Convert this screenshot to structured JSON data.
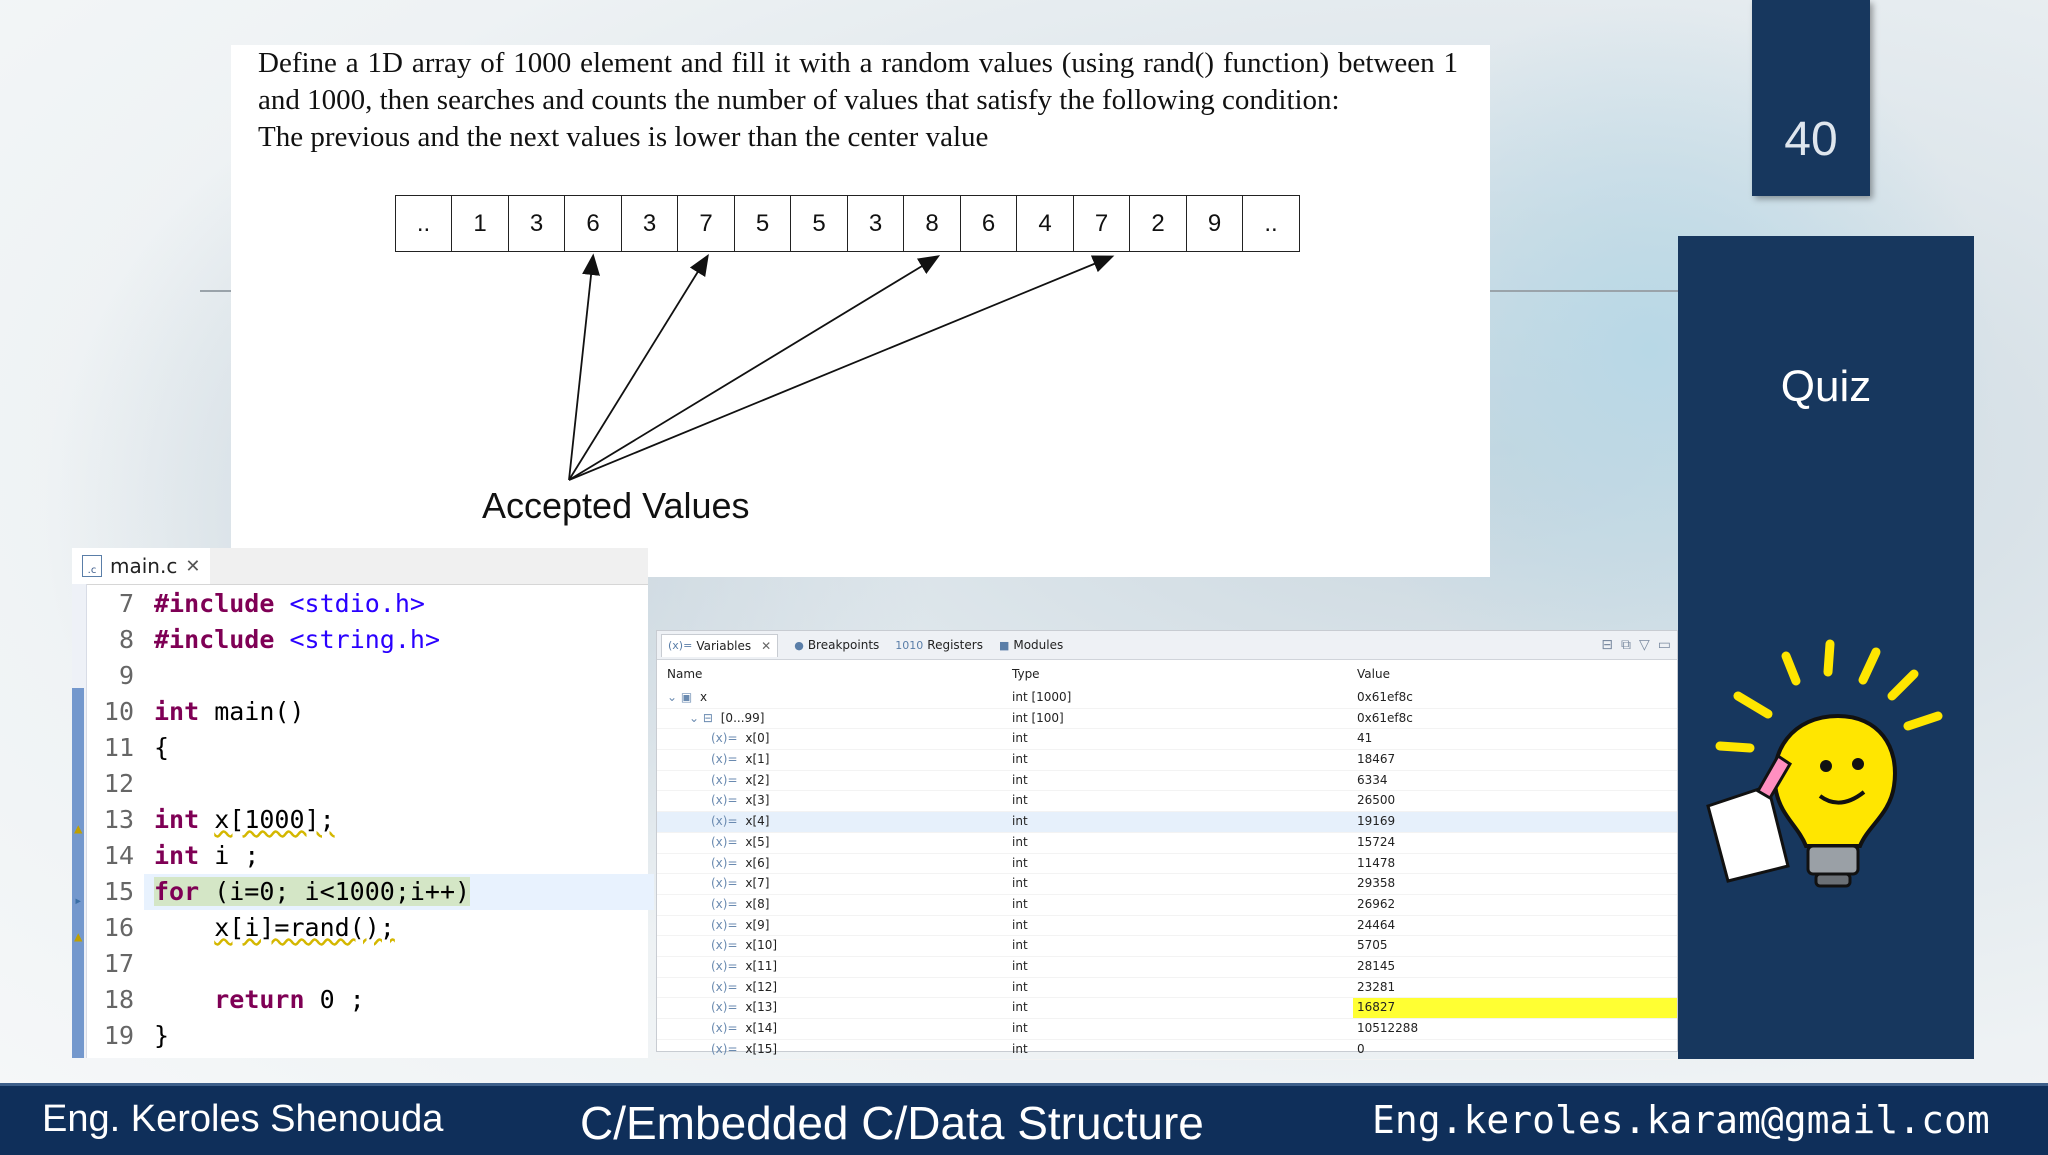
{
  "slide": {
    "number": "40",
    "quiz_title": "Quiz"
  },
  "problem": {
    "lines": [
      "Define a 1D array of 1000 element and fill it with a random values (using rand() function) between 1 and 1000, then searches and counts the number of values that satisfy the following condition:",
      "The previous and the next values is lower than the center value"
    ],
    "array_cells": [
      "..",
      "1",
      "3",
      "6",
      "3",
      "7",
      "5",
      "5",
      "3",
      "8",
      "6",
      "4",
      "7",
      "2",
      "9",
      ".."
    ],
    "accepted_label": "Accepted Values"
  },
  "editor": {
    "tab_label": "main.c",
    "code": [
      {
        "n": "7",
        "html": "<span class='kw'>#include</span> <span class='inc'>&lt;stdio.h&gt;</span>"
      },
      {
        "n": "8",
        "html": "<span class='kw'>#include</span> <span class='inc'>&lt;string.h&gt;</span>"
      },
      {
        "n": "9",
        "html": ""
      },
      {
        "n": "10",
        "html": "<span class='kw'>int</span> main()"
      },
      {
        "n": "11",
        "html": "{"
      },
      {
        "n": "12",
        "html": ""
      },
      {
        "n": "13",
        "html": "<span class='kw'>int</span> <span class='warn'>x[1000];</span>"
      },
      {
        "n": "14",
        "html": "<span class='kw'>int</span> i ;"
      },
      {
        "n": "15",
        "html": "<span class='hl-green'><span class='kw'>for</span> (i=0; i&lt;1000;i++)</span>"
      },
      {
        "n": "16",
        "html": "    <span class='warn'>x[i]=rand();</span>"
      },
      {
        "n": "17",
        "html": ""
      },
      {
        "n": "18",
        "html": "    <span class='kw'>return</span> 0 ;"
      },
      {
        "n": "19",
        "html": "}"
      }
    ]
  },
  "debugger": {
    "tabs": [
      {
        "icon": "(x)=",
        "label": "Variables"
      },
      {
        "icon": "●",
        "label": "Breakpoints"
      },
      {
        "icon": "1010",
        "label": "Registers"
      },
      {
        "icon": "■",
        "label": "Modules"
      }
    ],
    "headers": {
      "name": "Name",
      "type": "Type",
      "value": "Value"
    },
    "rows": [
      {
        "name": "x",
        "type": "int [1000]",
        "value": "0x61ef8c",
        "level": 0
      },
      {
        "name": "[0...99]",
        "type": "int [100]",
        "value": "0x61ef8c",
        "level": 1
      },
      {
        "name": "x[0]",
        "type": "int",
        "value": "41",
        "level": 2
      },
      {
        "name": "x[1]",
        "type": "int",
        "value": "18467",
        "level": 2
      },
      {
        "name": "x[2]",
        "type": "int",
        "value": "6334",
        "level": 2
      },
      {
        "name": "x[3]",
        "type": "int",
        "value": "26500",
        "level": 2
      },
      {
        "name": "x[4]",
        "type": "int",
        "value": "19169",
        "level": 2,
        "selected": true
      },
      {
        "name": "x[5]",
        "type": "int",
        "value": "15724",
        "level": 2
      },
      {
        "name": "x[6]",
        "type": "int",
        "value": "11478",
        "level": 2
      },
      {
        "name": "x[7]",
        "type": "int",
        "value": "29358",
        "level": 2
      },
      {
        "name": "x[8]",
        "type": "int",
        "value": "26962",
        "level": 2
      },
      {
        "name": "x[9]",
        "type": "int",
        "value": "24464",
        "level": 2
      },
      {
        "name": "x[10]",
        "type": "int",
        "value": "5705",
        "level": 2
      },
      {
        "name": "x[11]",
        "type": "int",
        "value": "28145",
        "level": 2
      },
      {
        "name": "x[12]",
        "type": "int",
        "value": "23281",
        "level": 2
      },
      {
        "name": "x[13]",
        "type": "int",
        "value": "16827",
        "level": 2,
        "highlight": true
      },
      {
        "name": "x[14]",
        "type": "int",
        "value": "10512288",
        "level": 2
      },
      {
        "name": "x[15]",
        "type": "int",
        "value": "0",
        "level": 2
      }
    ]
  },
  "footer": {
    "author": "Eng. Keroles Shenouda",
    "course": "C/Embedded C/Data Structure",
    "email": "Eng.keroles.karam@gmail.com"
  },
  "colors": {
    "navy": "#17375e",
    "footer": "#0f2f5a",
    "keyword": "#7f0055",
    "include": "#2a00ff",
    "highlight_yellow": "#ffff33"
  }
}
